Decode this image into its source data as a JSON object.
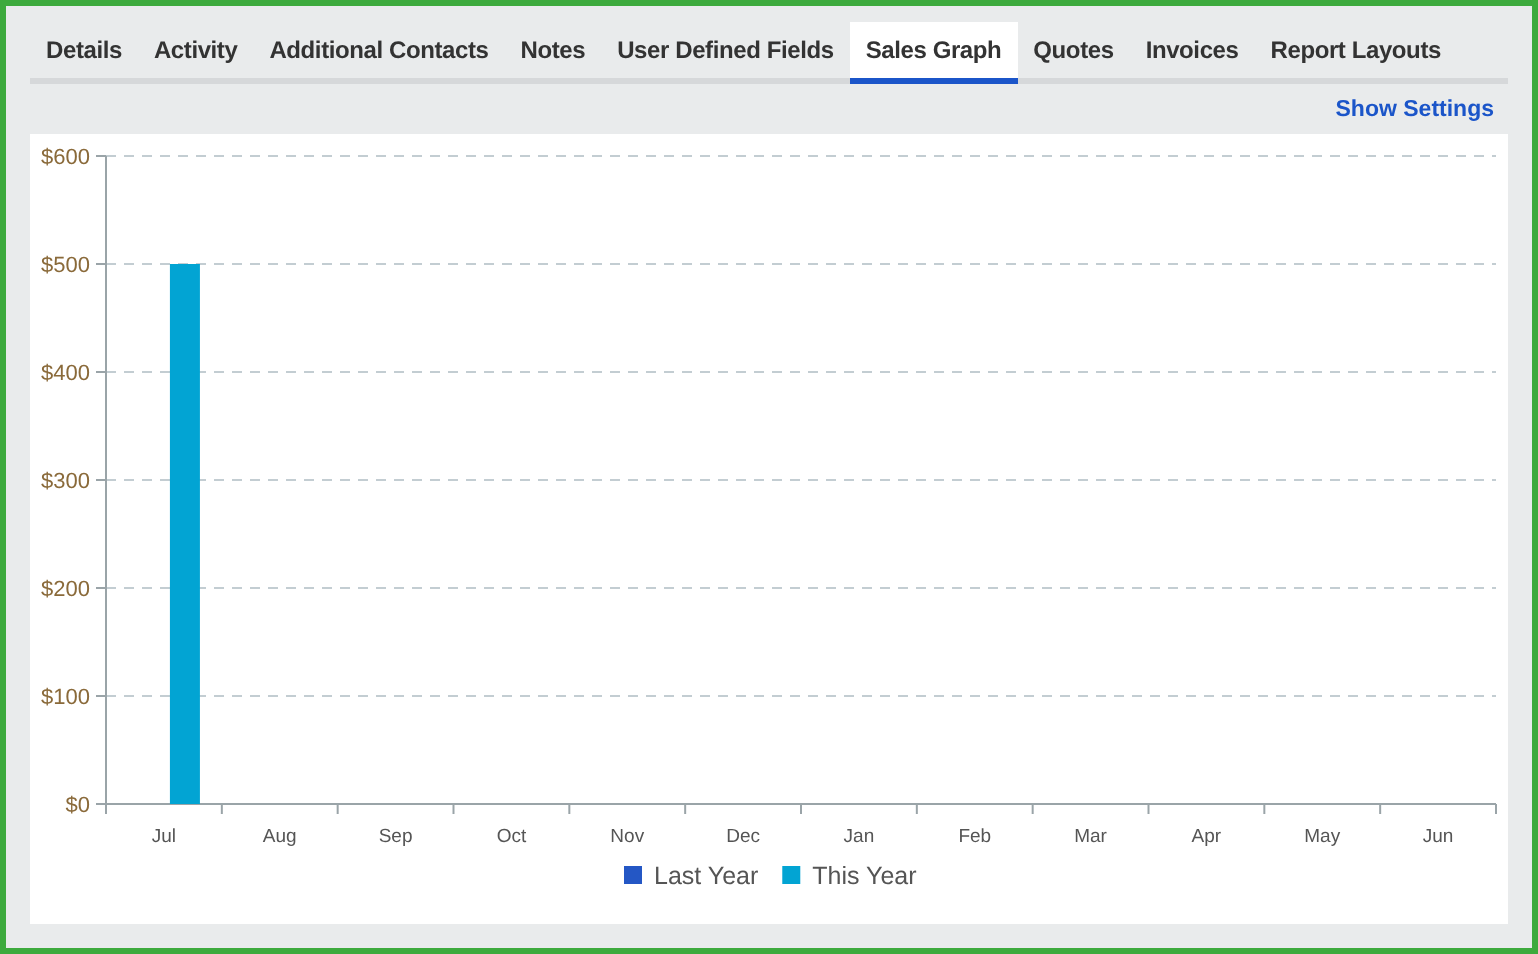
{
  "tabs": [
    {
      "label": "Details",
      "selected": false
    },
    {
      "label": "Activity",
      "selected": false
    },
    {
      "label": "Additional Contacts",
      "selected": false
    },
    {
      "label": "Notes",
      "selected": false
    },
    {
      "label": "User Defined Fields",
      "selected": false
    },
    {
      "label": "Sales Graph",
      "selected": true
    },
    {
      "label": "Quotes",
      "selected": false
    },
    {
      "label": "Invoices",
      "selected": false
    },
    {
      "label": "Report Layouts",
      "selected": false
    }
  ],
  "settings_link": "Show Settings",
  "chart_data": {
    "type": "bar",
    "categories": [
      "Jul",
      "Aug",
      "Sep",
      "Oct",
      "Nov",
      "Dec",
      "Jan",
      "Feb",
      "Mar",
      "Apr",
      "May",
      "Jun"
    ],
    "series": [
      {
        "name": "Last Year",
        "color": "#2457c5",
        "values": [
          0,
          0,
          0,
          0,
          0,
          0,
          0,
          0,
          0,
          0,
          0,
          0
        ]
      },
      {
        "name": "This Year",
        "color": "#02a4d3",
        "values": [
          500,
          0,
          0,
          0,
          0,
          0,
          0,
          0,
          0,
          0,
          0,
          0
        ]
      }
    ],
    "ylim": [
      0,
      600
    ],
    "grid": true,
    "yticks": [
      {
        "value": 0,
        "label": "$0"
      },
      {
        "value": 100,
        "label": "$100"
      },
      {
        "value": 200,
        "label": "$200"
      },
      {
        "value": 300,
        "label": "$300"
      },
      {
        "value": 400,
        "label": "$400"
      },
      {
        "value": 500,
        "label": "$500"
      },
      {
        "value": 600,
        "label": "$600"
      }
    ]
  }
}
